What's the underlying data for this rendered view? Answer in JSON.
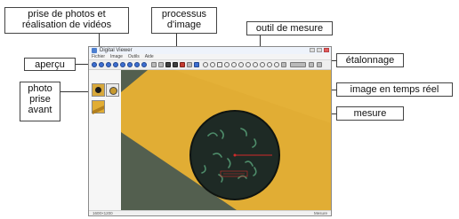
{
  "callouts": {
    "photo_video": "prise de photos et\nréalisation de vidéos",
    "processing": "processus\nd'image",
    "measure_tool": "outil de mesure",
    "calibration": "étalonnage",
    "preview": "aperçu",
    "photo_taken": "photo\nprise\navant",
    "realtime": "image en temps réel",
    "measure": "mesure"
  },
  "window": {
    "title": "Digital Viewer",
    "menu": [
      "Fichier",
      "Image",
      "Outils",
      "Aide"
    ],
    "status_left": "1600×1200",
    "status_right": "Mesure"
  },
  "colors": {
    "accent_blue": "#3d6ed1",
    "image_yellow": "#e1ad34",
    "image_dark": "#1e2a25",
    "measure_red": "#d22b2b"
  }
}
